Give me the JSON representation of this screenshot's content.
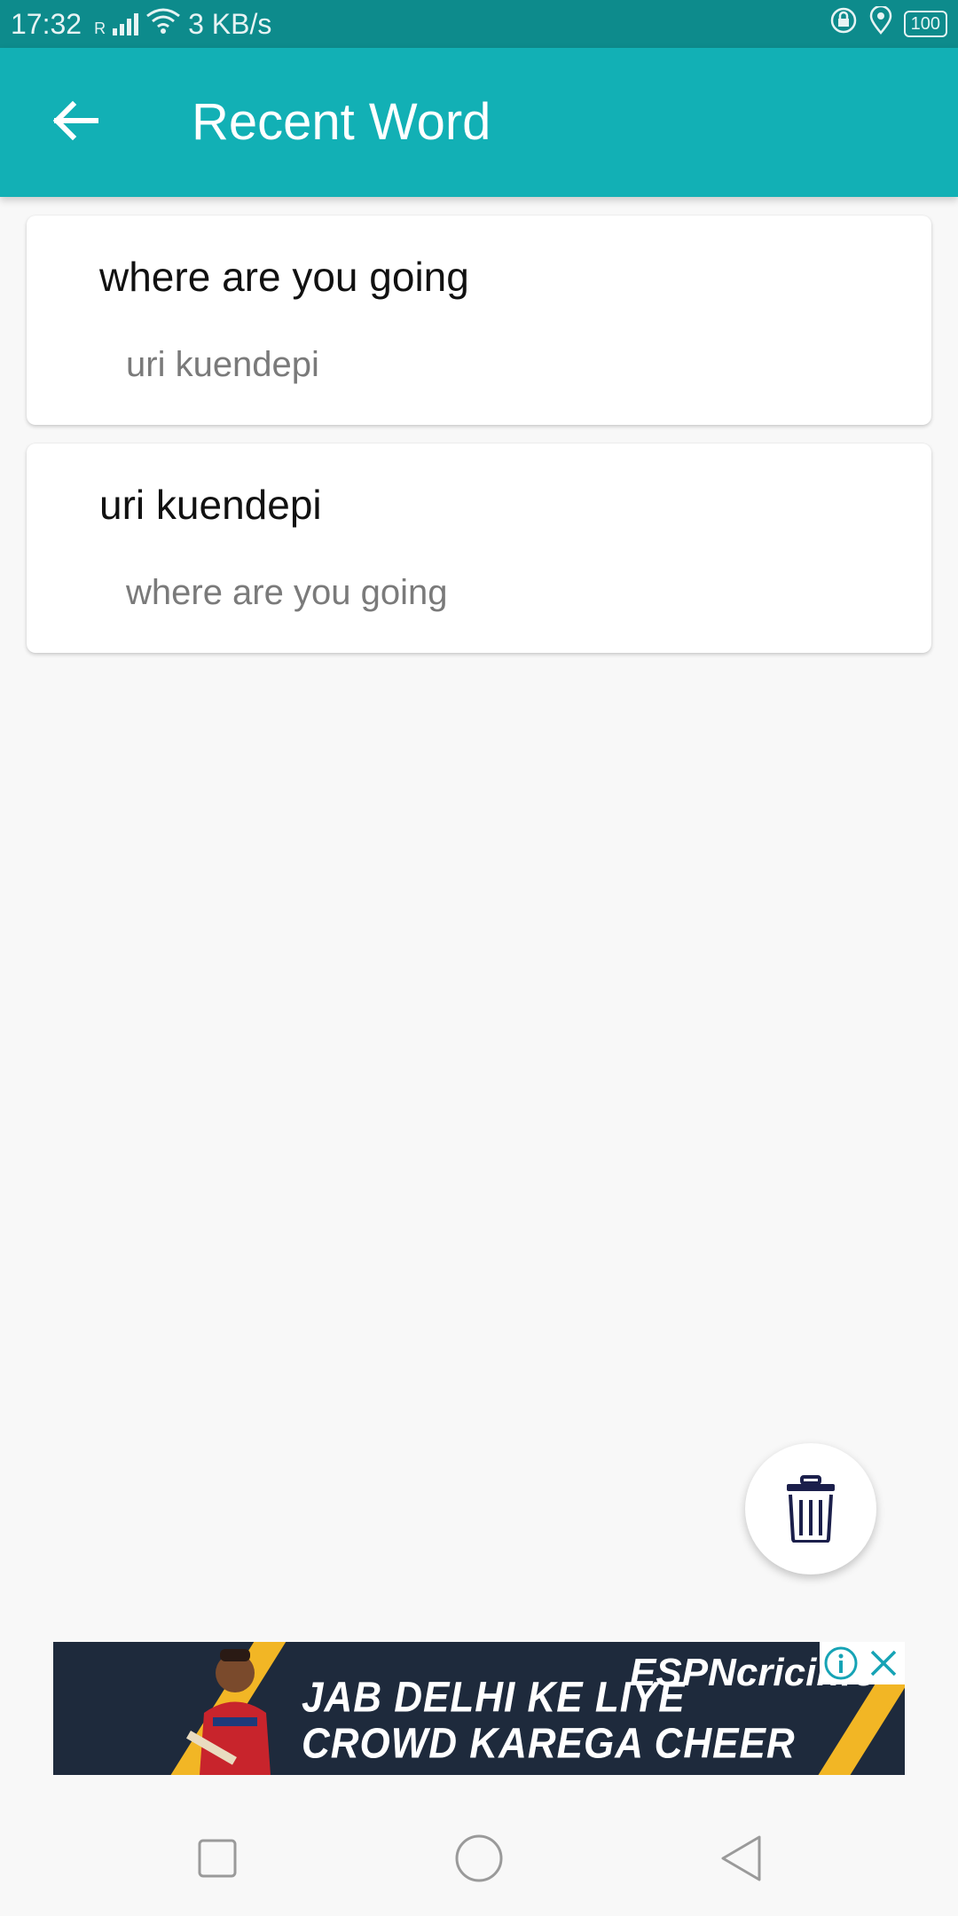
{
  "status_bar": {
    "time": "17:32",
    "network_label": "R",
    "speed": "3 KB/s",
    "battery": "100"
  },
  "app_bar": {
    "title": "Recent Word"
  },
  "recent_words": [
    {
      "title": "where are you going",
      "translation": "uri kuendepi"
    },
    {
      "title": "uri kuendepi",
      "translation": "where are you going"
    }
  ],
  "ad": {
    "line1": "JAB DELHI KE LIYE",
    "line2": "CROWD KAREGA CHEER",
    "brand": "ESPNcricinfo"
  },
  "icons": {
    "back": "arrow-left-icon",
    "delete": "trash-icon",
    "nav_recent": "square-icon",
    "nav_home": "circle-icon",
    "nav_back": "triangle-icon"
  },
  "colors": {
    "app_bar": "#12b0b5",
    "status_bar": "#0d8b8c",
    "fab_icon": "#1b1f4b"
  }
}
